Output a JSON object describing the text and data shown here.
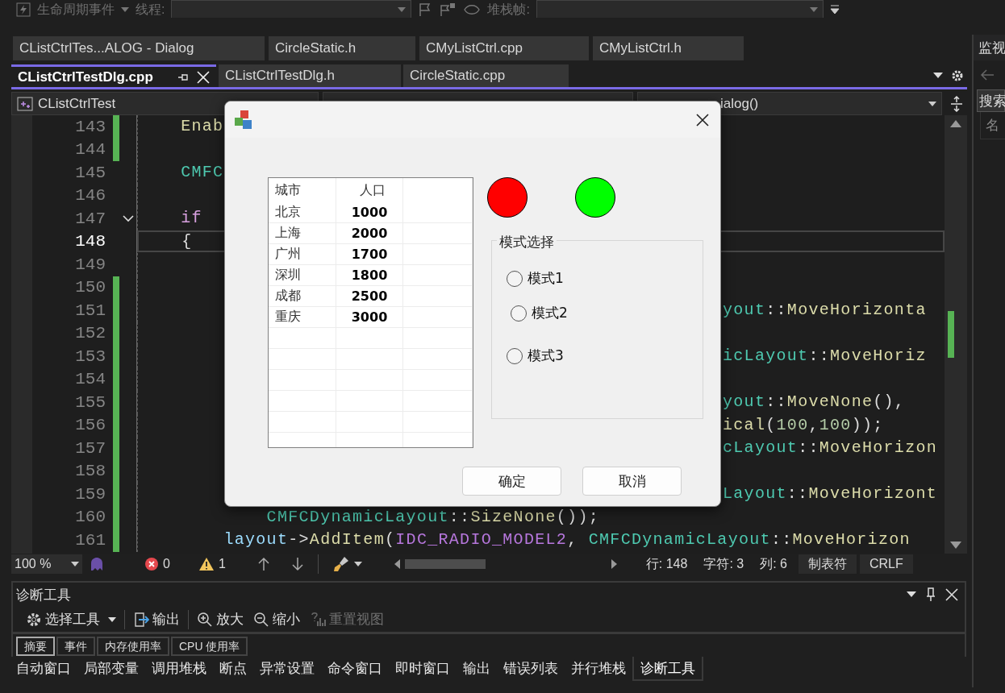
{
  "debug_toolbar": {
    "event": "生命周期事件",
    "thread_label": "线程:",
    "stack_label": "堆栈帧:"
  },
  "document_tabs": {
    "row_1": [
      {
        "label": "CListCtrlTes...ALOG - Dialog",
        "selected": false
      },
      {
        "label": "CircleStatic.h",
        "selected": false
      },
      {
        "label": "CMyListCtrl.cpp",
        "selected": false
      },
      {
        "label": "CMyListCtrl.h",
        "selected": false
      }
    ],
    "row_2": [
      {
        "label": "CListCtrlTestDlg.cpp",
        "selected": true
      },
      {
        "label": "CListCtrlTestDlg.h",
        "selected": false
      },
      {
        "label": "CircleStatic.cpp",
        "selected": false
      }
    ]
  },
  "navigation_bar": {
    "project": "CListCtrlTest",
    "member": "ialog()"
  },
  "editor": {
    "lines": [
      {
        "number": "143",
        "changed": true,
        "current": false,
        "foldable": false,
        "code": [
          {
            "kind": "func",
            "text": "    Enab"
          }
        ]
      },
      {
        "number": "144",
        "changed": true,
        "current": false,
        "foldable": false
      },
      {
        "number": "145",
        "changed": false,
        "current": false,
        "foldable": false,
        "code": [
          {
            "kind": "type",
            "text": "    CMFC"
          }
        ]
      },
      {
        "number": "146",
        "changed": false,
        "current": false,
        "foldable": false
      },
      {
        "number": "147",
        "changed": false,
        "current": false,
        "foldable": true,
        "code": [
          {
            "kind": "keyword",
            "text": "    if"
          }
        ]
      },
      {
        "number": "148",
        "changed": false,
        "current": true,
        "foldable": false,
        "code": [
          {
            "kind": "plain",
            "text": "    {"
          }
        ]
      },
      {
        "number": "149",
        "changed": false,
        "current": false,
        "foldable": false
      },
      {
        "number": "150",
        "changed": true,
        "current": false,
        "foldable": false
      },
      {
        "number": "151",
        "changed": true,
        "current": false,
        "foldable": false,
        "code_right": [
          {
            "kind": "type",
            "text": "yout"
          },
          {
            "kind": "plain",
            "text": "::"
          },
          {
            "kind": "func",
            "text": "MoveHorizonta"
          }
        ]
      },
      {
        "number": "152",
        "changed": true,
        "current": false,
        "foldable": false
      },
      {
        "number": "153",
        "changed": true,
        "current": false,
        "foldable": false,
        "code_right": [
          {
            "kind": "type",
            "text": "icLayout"
          },
          {
            "kind": "plain",
            "text": "::"
          },
          {
            "kind": "func",
            "text": "MoveHoriz"
          }
        ]
      },
      {
        "number": "154",
        "changed": true,
        "current": false,
        "foldable": false
      },
      {
        "number": "155",
        "changed": true,
        "current": false,
        "foldable": false,
        "code_right": [
          {
            "kind": "type",
            "text": "yout"
          },
          {
            "kind": "plain",
            "text": "::"
          },
          {
            "kind": "func",
            "text": "MoveNone"
          },
          {
            "kind": "plain",
            "text": "(),"
          }
        ]
      },
      {
        "number": "156",
        "changed": true,
        "current": false,
        "foldable": false,
        "code_right": [
          {
            "kind": "func",
            "text": "ical"
          },
          {
            "kind": "plain",
            "text": "("
          },
          {
            "kind": "number",
            "text": "100"
          },
          {
            "kind": "plain",
            "text": ","
          },
          {
            "kind": "number",
            "text": "100"
          },
          {
            "kind": "plain",
            "text": "));"
          }
        ]
      },
      {
        "number": "157",
        "changed": true,
        "current": false,
        "foldable": false,
        "code_right": [
          {
            "kind": "type",
            "text": "cLayout"
          },
          {
            "kind": "plain",
            "text": "::"
          },
          {
            "kind": "func",
            "text": "MoveHorizon"
          }
        ]
      },
      {
        "number": "158",
        "changed": true,
        "current": false,
        "foldable": false
      },
      {
        "number": "159",
        "changed": true,
        "current": false,
        "foldable": false,
        "code_right": [
          {
            "kind": "type",
            "text": "Layout"
          },
          {
            "kind": "plain",
            "text": "::"
          },
          {
            "kind": "func",
            "text": "MoveHorizont"
          }
        ]
      },
      {
        "number": "160",
        "changed": true,
        "current": false,
        "foldable": false,
        "code": [
          {
            "kind": "type",
            "text": "            CMFCDynamicLayout"
          },
          {
            "kind": "plain",
            "text": "::"
          },
          {
            "kind": "func",
            "text": "SizeNone"
          },
          {
            "kind": "plain",
            "text": "());"
          }
        ]
      },
      {
        "number": "161",
        "changed": true,
        "current": false,
        "foldable": false,
        "code": [
          {
            "kind": "var",
            "text": "        layout"
          },
          {
            "kind": "plain",
            "text": "->"
          },
          {
            "kind": "func",
            "text": "AddItem"
          },
          {
            "kind": "plain",
            "text": "("
          },
          {
            "kind": "macro",
            "text": "IDC_RADIO_MODEL2"
          },
          {
            "kind": "plain",
            "text": ", "
          },
          {
            "kind": "type",
            "text": "CMFCDynamicLayout"
          },
          {
            "kind": "plain",
            "text": "::"
          },
          {
            "kind": "func",
            "text": "MoveHorizon"
          }
        ]
      }
    ]
  },
  "status_bar": {
    "zoom": "100 %",
    "errors": "0",
    "warnings": "1",
    "line": "行: 148",
    "char": "字符: 3",
    "column": "列: 6",
    "indent": "制表符",
    "line_ending": "CRLF"
  },
  "side_panel": {
    "title": "监视",
    "search": "搜索",
    "column": "名"
  },
  "diagnostic_tools": {
    "title": "诊断工具",
    "toolbar": [
      {
        "kind": "gear",
        "label": "选择工具",
        "menu": true,
        "disabled": false
      },
      {
        "kind": "output",
        "label": "输出",
        "menu": false,
        "disabled": false
      },
      {
        "kind": "zoom_in",
        "label": "放大",
        "menu": false,
        "disabled": false
      },
      {
        "kind": "zoom_out",
        "label": "缩小",
        "menu": false,
        "disabled": false
      },
      {
        "kind": "reset",
        "label": "重置视图",
        "menu": false,
        "disabled": true
      }
    ],
    "tabs": [
      {
        "label": "摘要",
        "selected": true
      },
      {
        "label": "事件",
        "selected": false
      },
      {
        "label": "内存使用率",
        "selected": false
      },
      {
        "label": "CPU 使用率",
        "selected": false
      }
    ]
  },
  "tool_window_tabs": [
    {
      "label": "自动窗口",
      "selected": false
    },
    {
      "label": "局部变量",
      "selected": false
    },
    {
      "label": "调用堆栈",
      "selected": false
    },
    {
      "label": "断点",
      "selected": false
    },
    {
      "label": "异常设置",
      "selected": false
    },
    {
      "label": "命令窗口",
      "selected": false
    },
    {
      "label": "即时窗口",
      "selected": false
    },
    {
      "label": "输出",
      "selected": false
    },
    {
      "label": "错误列表",
      "selected": false
    },
    {
      "label": "并行堆栈",
      "selected": false
    },
    {
      "label": "诊断工具",
      "selected": true
    }
  ],
  "dialog": {
    "list": {
      "columns": [
        "城市",
        "人口"
      ],
      "rows": [
        [
          "北京",
          "1000"
        ],
        [
          "上海",
          "2000"
        ],
        [
          "广州",
          "1700"
        ],
        [
          "深圳",
          "1800"
        ],
        [
          "成都",
          "2500"
        ],
        [
          "重庆",
          "3000"
        ]
      ]
    },
    "indicators": [
      {
        "color": "#ff0000"
      },
      {
        "color": "#00ff00"
      }
    ],
    "group": {
      "title": "模式选择",
      "options": [
        {
          "label": "模式1",
          "selected": false
        },
        {
          "label": "模式2",
          "selected": false
        },
        {
          "label": "模式3",
          "selected": false
        }
      ]
    },
    "buttons": [
      "确定",
      "取消"
    ]
  }
}
